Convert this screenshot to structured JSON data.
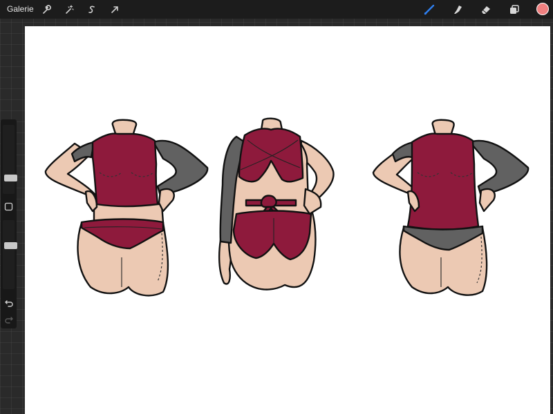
{
  "toolbar": {
    "gallery_label": "Galerie",
    "left_tools": [
      "wrench-icon",
      "magic-wand-icon",
      "selection-icon",
      "transform-arrow-icon"
    ],
    "right_tools": [
      "brush-icon",
      "smudge-icon",
      "eraser-icon",
      "layers-icon"
    ],
    "active_tool": "brush-icon",
    "active_color": "#f08080",
    "brush_accent": "#2f7ff0"
  },
  "sidebar": {
    "brush_size_level": 0.38,
    "opacity_level": 0.35,
    "buttons": [
      "modify-button-icon",
      "undo-icon",
      "redo-icon"
    ]
  },
  "artwork": {
    "colors": {
      "swimsuit": "#8e1a3c",
      "sleeves": "#616161",
      "skin": "#ecc9b3",
      "outline": "#111111"
    }
  }
}
